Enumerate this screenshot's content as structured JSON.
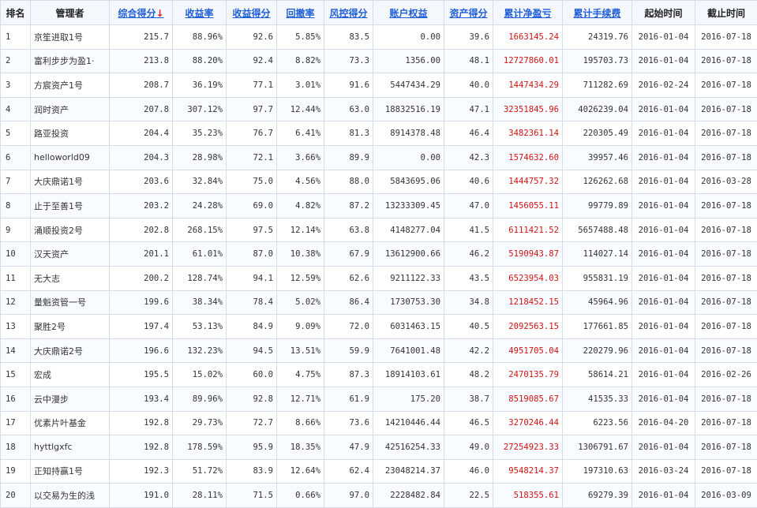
{
  "table": {
    "headers": [
      {
        "label": "排名",
        "arrow": ""
      },
      {
        "label": "管理者",
        "arrow": ""
      },
      {
        "label": "综合得分",
        "arrow": "↓"
      },
      {
        "label": "收益率",
        "arrow": ""
      },
      {
        "label": "收益得分",
        "arrow": ""
      },
      {
        "label": "回撤率",
        "arrow": ""
      },
      {
        "label": "风控得分",
        "arrow": ""
      },
      {
        "label": "账户权益",
        "arrow": ""
      },
      {
        "label": "资产得分",
        "arrow": ""
      },
      {
        "label": "累计净盈亏",
        "arrow": ""
      },
      {
        "label": "累计手续费",
        "arrow": ""
      },
      {
        "label": "起始时间",
        "arrow": ""
      },
      {
        "label": "截止时间",
        "arrow": ""
      }
    ],
    "rows": [
      [
        "1",
        "京笙进取1号",
        "215.7",
        "88.96%",
        "92.6",
        "5.85%",
        "83.5",
        "0.00",
        "39.6",
        "1663145.24",
        "24319.76",
        "2016-01-04",
        "2016-07-18"
      ],
      [
        "2",
        "富利步步为盈1·",
        "213.8",
        "88.20%",
        "92.4",
        "8.82%",
        "73.3",
        "1356.00",
        "48.1",
        "12727860.01",
        "195703.73",
        "2016-01-04",
        "2016-07-18"
      ],
      [
        "3",
        "方宸资产1号",
        "208.7",
        "36.19%",
        "77.1",
        "3.01%",
        "91.6",
        "5447434.29",
        "40.0",
        "1447434.29",
        "711282.69",
        "2016-02-24",
        "2016-07-18"
      ],
      [
        "4",
        "润时资产",
        "207.8",
        "307.12%",
        "97.7",
        "12.44%",
        "63.0",
        "18832516.19",
        "47.1",
        "32351845.96",
        "4026239.04",
        "2016-01-04",
        "2016-07-18"
      ],
      [
        "5",
        "路亚投资",
        "204.4",
        "35.23%",
        "76.7",
        "6.41%",
        "81.3",
        "8914378.48",
        "46.4",
        "3482361.14",
        "220305.49",
        "2016-01-04",
        "2016-07-18"
      ],
      [
        "6",
        "helloworld09",
        "204.3",
        "28.98%",
        "72.1",
        "3.66%",
        "89.9",
        "0.00",
        "42.3",
        "1574632.60",
        "39957.46",
        "2016-01-04",
        "2016-07-18"
      ],
      [
        "7",
        "大庆鼎诺1号",
        "203.6",
        "32.84%",
        "75.0",
        "4.56%",
        "88.0",
        "5843695.06",
        "40.6",
        "1444757.32",
        "126262.68",
        "2016-01-04",
        "2016-03-28"
      ],
      [
        "8",
        "止于至善1号",
        "203.2",
        "24.28%",
        "69.0",
        "4.82%",
        "87.2",
        "13233309.45",
        "47.0",
        "1456055.11",
        "99779.89",
        "2016-01-04",
        "2016-07-18"
      ],
      [
        "9",
        "涌顺投资2号",
        "202.8",
        "268.15%",
        "97.5",
        "12.14%",
        "63.8",
        "4148277.04",
        "41.5",
        "6111421.52",
        "5657488.48",
        "2016-01-04",
        "2016-07-18"
      ],
      [
        "10",
        "汉天资产",
        "201.1",
        "61.01%",
        "87.0",
        "10.38%",
        "67.9",
        "13612900.66",
        "46.2",
        "5190943.87",
        "114027.14",
        "2016-01-04",
        "2016-07-18"
      ],
      [
        "11",
        "无大志",
        "200.2",
        "128.74%",
        "94.1",
        "12.59%",
        "62.6",
        "9211122.33",
        "43.5",
        "6523954.03",
        "955831.19",
        "2016-01-04",
        "2016-07-18"
      ],
      [
        "12",
        "量魁资管一号",
        "199.6",
        "38.34%",
        "78.4",
        "5.02%",
        "86.4",
        "1730753.30",
        "34.8",
        "1218452.15",
        "45964.96",
        "2016-01-04",
        "2016-07-18"
      ],
      [
        "13",
        "聚胜2号",
        "197.4",
        "53.13%",
        "84.9",
        "9.09%",
        "72.0",
        "6031463.15",
        "40.5",
        "2092563.15",
        "177661.85",
        "2016-01-04",
        "2016-07-18"
      ],
      [
        "14",
        "大庆鼎诺2号",
        "196.6",
        "132.23%",
        "94.5",
        "13.51%",
        "59.9",
        "7641001.48",
        "42.2",
        "4951705.04",
        "220279.96",
        "2016-01-04",
        "2016-07-18"
      ],
      [
        "15",
        "宏成",
        "195.5",
        "15.02%",
        "60.0",
        "4.75%",
        "87.3",
        "18914103.61",
        "48.2",
        "2470135.79",
        "58614.21",
        "2016-01-04",
        "2016-02-26"
      ],
      [
        "16",
        "云中漫步",
        "193.4",
        "89.96%",
        "92.8",
        "12.71%",
        "61.9",
        "175.20",
        "38.7",
        "8519085.67",
        "41535.33",
        "2016-01-04",
        "2016-07-18"
      ],
      [
        "17",
        "优素片叶基金",
        "192.8",
        "29.73%",
        "72.7",
        "8.66%",
        "73.6",
        "14210446.44",
        "46.5",
        "3270246.44",
        "6223.56",
        "2016-04-20",
        "2016-07-18"
      ],
      [
        "18",
        "hyttlgxfc",
        "192.8",
        "178.59%",
        "95.9",
        "18.35%",
        "47.9",
        "42516254.33",
        "49.0",
        "27254923.33",
        "1306791.67",
        "2016-01-04",
        "2016-07-18"
      ],
      [
        "19",
        "正知持赢1号",
        "192.3",
        "51.72%",
        "83.9",
        "12.64%",
        "62.4",
        "23048214.37",
        "46.0",
        "9548214.37",
        "197310.63",
        "2016-03-24",
        "2016-07-18"
      ],
      [
        "20",
        "以交易为生的浅",
        "191.0",
        "28.11%",
        "71.5",
        "0.66%",
        "97.0",
        "2228482.84",
        "22.5",
        "518355.61",
        "69279.39",
        "2016-01-04",
        "2016-03-09"
      ]
    ]
  },
  "colors": {
    "link": "#1f5ed8",
    "profit": "#d01414",
    "sort_arrow": "#e21b1b"
  }
}
